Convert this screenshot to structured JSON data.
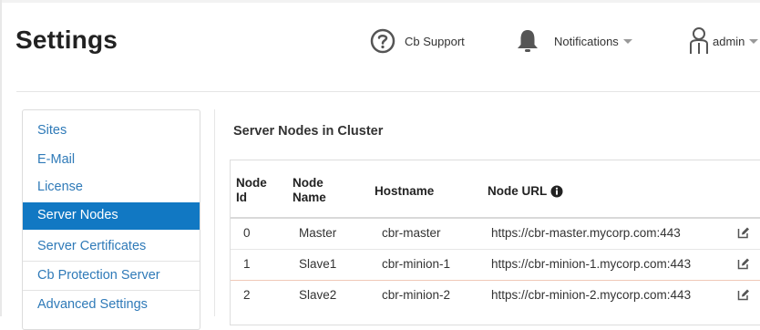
{
  "header": {
    "title": "Settings",
    "support_label": "Cb Support",
    "notifications_label": "Notifications",
    "user_label": "admin"
  },
  "sidebar": {
    "items": [
      {
        "label": "Sites"
      },
      {
        "label": "E-Mail"
      },
      {
        "label": "License"
      },
      {
        "label": "Server Nodes",
        "active": true
      },
      {
        "label": "Server Certificates"
      },
      {
        "label": "Cb Protection Server"
      },
      {
        "label": "Advanced Settings"
      }
    ]
  },
  "main": {
    "section_title": "Server Nodes in Cluster",
    "table": {
      "columns": [
        "Node Id",
        "Node Name",
        "Hostname",
        "Node URL"
      ],
      "rows": [
        {
          "id": "0",
          "name": "Master",
          "hostname": "cbr-master",
          "url": "https://cbr-master.mycorp.com:443"
        },
        {
          "id": "1",
          "name": "Slave1",
          "hostname": "cbr-minion-1",
          "url": "https://cbr-minion-1.mycorp.com:443"
        },
        {
          "id": "2",
          "name": "Slave2",
          "hostname": "cbr-minion-2",
          "url": "https://cbr-minion-2.mycorp.com:443"
        }
      ]
    }
  },
  "colors": {
    "accent": "#1178c3",
    "link": "#2f7ab8",
    "icon": "#555555"
  },
  "icons": [
    "question-circle-icon",
    "bell-icon",
    "user-icon",
    "info-icon",
    "edit-icon"
  ]
}
